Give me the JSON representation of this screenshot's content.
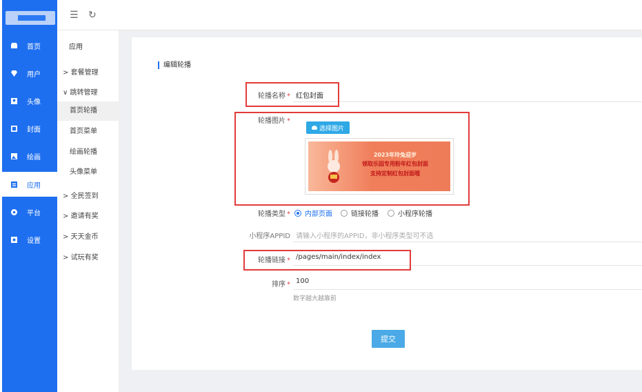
{
  "nav": {
    "items": [
      {
        "label": "首页",
        "icon": "home-icon"
      },
      {
        "label": "用户",
        "icon": "diamond-icon"
      },
      {
        "label": "头像",
        "icon": "image-icon"
      },
      {
        "label": "封面",
        "icon": "picture-icon"
      },
      {
        "label": "绘画",
        "icon": "palette-icon"
      },
      {
        "label": "应用",
        "icon": "app-icon",
        "active": true
      },
      {
        "label": "平台",
        "icon": "platform-icon"
      },
      {
        "label": "设置",
        "icon": "settings-icon"
      }
    ]
  },
  "topbar": {
    "collapse_icon": "☰",
    "refresh_icon": "↻"
  },
  "subnav": {
    "title": "应用",
    "groups": [
      {
        "label": "套餐管理",
        "prefix": ">"
      },
      {
        "label": "跳转管理",
        "prefix": "∨"
      }
    ],
    "children": [
      {
        "label": "首页轮播",
        "active": true
      },
      {
        "label": "首页菜单"
      },
      {
        "label": "绘画轮播"
      },
      {
        "label": "头像菜单"
      }
    ],
    "more_groups": [
      {
        "label": "全民签到",
        "prefix": ">"
      },
      {
        "label": "邀请有奖",
        "prefix": ">"
      },
      {
        "label": "天天金币",
        "prefix": ">"
      },
      {
        "label": "试玩有奖",
        "prefix": ">"
      }
    ]
  },
  "form": {
    "title": "编辑轮播",
    "name_label": "轮播名称",
    "name_value": "红包封面",
    "image_label": "轮播图片",
    "select_button": "选择图片",
    "banner_line1": "2023年玲兔迎岁",
    "banner_line2": "领取乐园专用粉年红包封面",
    "banner_line3": "支持定制红包封面哦",
    "type_label": "轮播类型",
    "type_options": [
      "内部页面",
      "链接轮播",
      "小程序轮播"
    ],
    "type_selected": "内部页面",
    "appid_label": "小程序APPID",
    "appid_placeholder": "请输入小程序的APPID，非小程序类型可不选",
    "link_label": "轮播链接",
    "link_value": "/pages/main/index/index",
    "sort_label": "排序",
    "sort_value": "100",
    "sort_hint": "数字越大越靠前",
    "submit_label": "提交",
    "required_mark": "*"
  },
  "colors": {
    "primary": "#1e6ff0",
    "highlight": "#e23a3a",
    "button": "#4aa9e6"
  }
}
